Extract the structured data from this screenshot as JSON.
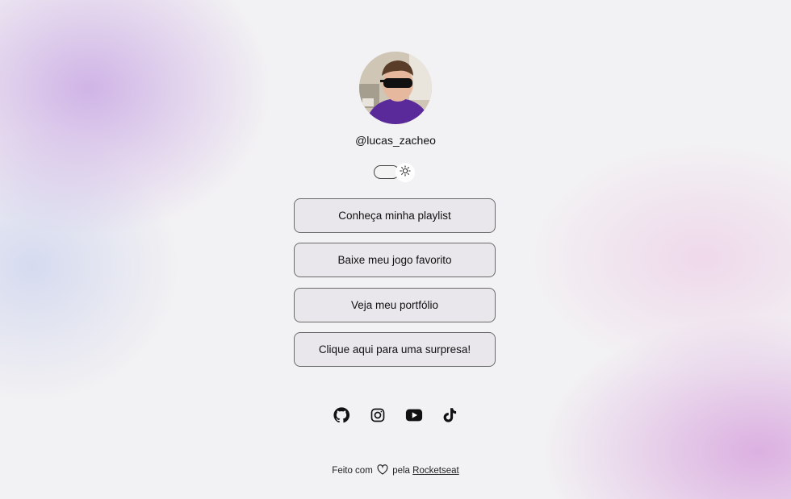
{
  "profile": {
    "handle": "@lucas_zacheo"
  },
  "theme_toggle": {
    "icon": "sun-icon"
  },
  "links": [
    {
      "label": "Conheça minha playlist"
    },
    {
      "label": "Baixe meu jogo favorito"
    },
    {
      "label": "Veja meu portfólio"
    },
    {
      "label": "Clique aqui para uma surpresa!"
    }
  ],
  "socials": [
    "github-icon",
    "instagram-icon",
    "youtube-icon",
    "tiktok-icon"
  ],
  "footer": {
    "prefix": "Feito com",
    "middle": "pela",
    "link": "Rocketseat"
  }
}
